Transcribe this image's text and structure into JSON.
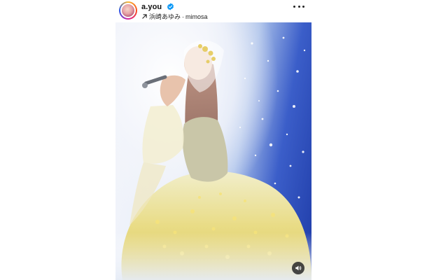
{
  "post": {
    "username": "a.you",
    "verified": true,
    "audio": {
      "artist": "浜崎あゆみ",
      "separator": "·",
      "track": "mimosa"
    }
  },
  "icons": {
    "audio": "arrow-up-right-icon",
    "more": "more-horizontal-icon",
    "verified": "verified-badge-icon",
    "sound": "speaker-icon"
  },
  "colors": {
    "verified": "#0095f6",
    "text": "#111111",
    "stage_blue": "#1f3ca8"
  }
}
